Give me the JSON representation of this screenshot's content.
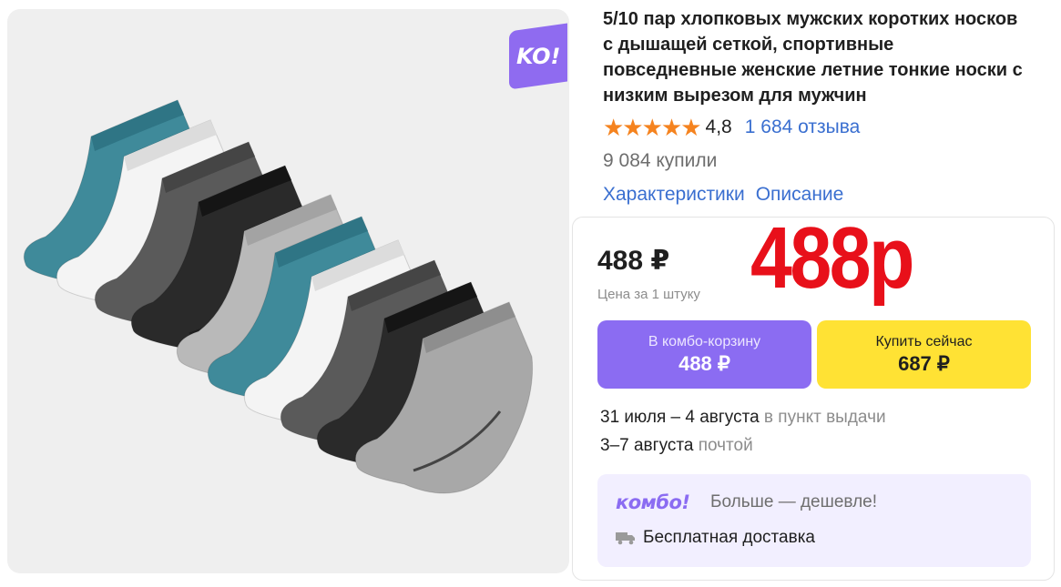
{
  "badge": {
    "text": "KO!"
  },
  "product": {
    "title": "5/10 пар хлопковых мужских коротких носков с дышащей сеткой, спортивные повседневные женские летние тонкие носки с низким вырезом для мужчин",
    "stars": "★★★★★",
    "rating": "4,8",
    "reviews": "1 684 отзыва",
    "bought": "9 084 купили"
  },
  "tabs": [
    {
      "label": "Характеристики"
    },
    {
      "label": "Описание"
    }
  ],
  "buy": {
    "price": "488 ₽",
    "price_note": "Цена за 1 штуку",
    "overlay_price": "488р",
    "combo_button": {
      "label": "В комбо-корзину",
      "price": "488 ₽"
    },
    "buy_button": {
      "label": "Купить сейчас",
      "price": "687 ₽"
    },
    "delivery": [
      {
        "date": "31 июля – 4 августа",
        "method": "в пункт выдачи"
      },
      {
        "date": "3–7 августа",
        "method": "почтой"
      }
    ],
    "combo": {
      "logo": "комбо!",
      "text": "Больше — дешевле!",
      "free_delivery": "Бесплатная доставка"
    }
  },
  "colors": {
    "accent_purple": "#8b6cf2",
    "buy_yellow": "#ffe234",
    "link_blue": "#3a6fd0",
    "star_orange": "#f5831f",
    "overlay_red": "#e8101a"
  },
  "icons": [
    "star-icon",
    "truck-icon"
  ]
}
